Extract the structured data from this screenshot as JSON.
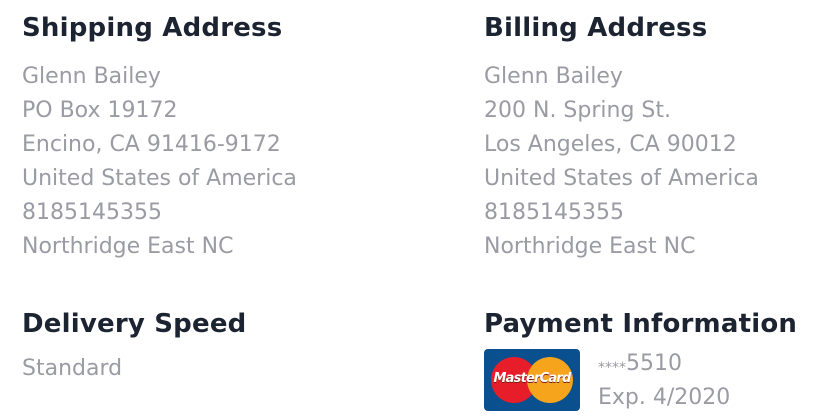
{
  "shipping": {
    "heading": "Shipping Address",
    "lines": [
      "Glenn Bailey",
      "PO Box 19172",
      "Encino, CA 91416-9172",
      "United States of America",
      "8185145355",
      "Northridge East NC"
    ]
  },
  "billing": {
    "heading": "Billing Address",
    "lines": [
      "Glenn Bailey",
      "200 N. Spring St.",
      "Los Angeles, CA 90012",
      "United States of America",
      "8185145355",
      "Northridge East NC"
    ]
  },
  "delivery": {
    "heading": "Delivery Speed",
    "value": "Standard"
  },
  "payment": {
    "heading": "Payment Information",
    "card_brand": "MasterCard",
    "card_mask": "****",
    "card_last4": "5510",
    "expiry": "Exp. 4/2020",
    "card_icon": "mastercard-icon",
    "colors": {
      "card_bg": "#0a4f8e",
      "red": "#e71d2a",
      "yellow": "#f6a41b"
    }
  }
}
